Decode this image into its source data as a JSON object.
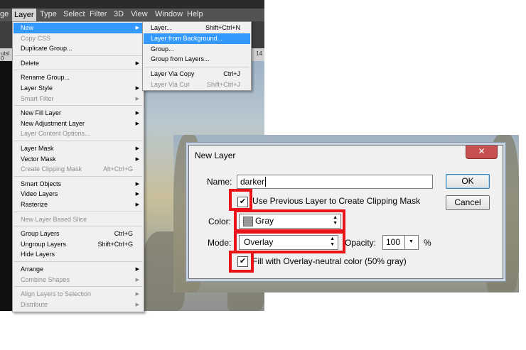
{
  "menubar": {
    "items": [
      "ge",
      "Layer",
      "Type",
      "Select",
      "Filter",
      "3D",
      "View",
      "Window",
      "Help"
    ]
  },
  "ruler": {
    "left_numbers": [
      "utsl",
      "0"
    ],
    "right_number": "14"
  },
  "layer_menu": {
    "items": [
      {
        "label": "New",
        "shortcut": "",
        "submenu": true,
        "disabled": false,
        "highlighted": true
      },
      {
        "label": "Copy CSS",
        "shortcut": "",
        "submenu": false,
        "disabled": true
      },
      {
        "label": "Duplicate Group...",
        "shortcut": "",
        "submenu": false,
        "disabled": false
      },
      {
        "label": "Delete",
        "shortcut": "",
        "submenu": true,
        "disabled": false
      },
      {
        "label": "Rename Group...",
        "shortcut": "",
        "submenu": false,
        "disabled": false
      },
      {
        "label": "Layer Style",
        "shortcut": "",
        "submenu": true,
        "disabled": false
      },
      {
        "label": "Smart Filter",
        "shortcut": "",
        "submenu": true,
        "disabled": true
      },
      {
        "label": "New Fill Layer",
        "shortcut": "",
        "submenu": true,
        "disabled": false
      },
      {
        "label": "New Adjustment Layer",
        "shortcut": "",
        "submenu": true,
        "disabled": false
      },
      {
        "label": "Layer Content Options...",
        "shortcut": "",
        "submenu": false,
        "disabled": true
      },
      {
        "label": "Layer Mask",
        "shortcut": "",
        "submenu": true,
        "disabled": false
      },
      {
        "label": "Vector Mask",
        "shortcut": "",
        "submenu": true,
        "disabled": false
      },
      {
        "label": "Create Clipping Mask",
        "shortcut": "Alt+Ctrl+G",
        "submenu": false,
        "disabled": true
      },
      {
        "label": "Smart Objects",
        "shortcut": "",
        "submenu": true,
        "disabled": false
      },
      {
        "label": "Video Layers",
        "shortcut": "",
        "submenu": true,
        "disabled": false
      },
      {
        "label": "Rasterize",
        "shortcut": "",
        "submenu": true,
        "disabled": false
      },
      {
        "label": "New Layer Based Slice",
        "shortcut": "",
        "submenu": false,
        "disabled": true
      },
      {
        "label": "Group Layers",
        "shortcut": "Ctrl+G",
        "submenu": false,
        "disabled": false
      },
      {
        "label": "Ungroup Layers",
        "shortcut": "Shift+Ctrl+G",
        "submenu": false,
        "disabled": false
      },
      {
        "label": "Hide Layers",
        "shortcut": "",
        "submenu": false,
        "disabled": false
      },
      {
        "label": "Arrange",
        "shortcut": "",
        "submenu": true,
        "disabled": false
      },
      {
        "label": "Combine Shapes",
        "shortcut": "",
        "submenu": true,
        "disabled": true
      },
      {
        "label": "Align Layers to Selection",
        "shortcut": "",
        "submenu": true,
        "disabled": true
      },
      {
        "label": "Distribute",
        "shortcut": "",
        "submenu": true,
        "disabled": true
      }
    ]
  },
  "new_submenu": {
    "items": [
      {
        "label": "Layer...",
        "shortcut": "Shift+Ctrl+N",
        "disabled": false,
        "highlighted": false
      },
      {
        "label": "Layer from Background...",
        "shortcut": "",
        "disabled": false,
        "highlighted": true
      },
      {
        "label": "Group...",
        "shortcut": "",
        "disabled": false,
        "highlighted": false
      },
      {
        "label": "Group from Layers...",
        "shortcut": "",
        "disabled": false,
        "highlighted": false
      },
      {
        "label": "Layer Via Copy",
        "shortcut": "Ctrl+J",
        "disabled": false,
        "highlighted": false
      },
      {
        "label": "Layer Via Cut",
        "shortcut": "Shift+Ctrl+J",
        "disabled": true,
        "highlighted": false
      }
    ]
  },
  "dialog": {
    "title": "New Layer",
    "close_glyph": "✕",
    "name_label": "Name:",
    "name_value": "darker",
    "ok_label": "OK",
    "cancel_label": "Cancel",
    "clip_checked": true,
    "clip_label": "Use Previous Layer to Create Clipping Mask",
    "color_label": "Color:",
    "color_value": "Gray",
    "mode_label": "Mode:",
    "mode_value": "Overlay",
    "opacity_label": "Opacity:",
    "opacity_value": "100",
    "opacity_unit": "%",
    "fill_checked": true,
    "fill_label": "Fill with Overlay-neutral color (50% gray)"
  },
  "colors": {
    "highlight": "#3399ff",
    "annotation_red": "#e8141a",
    "close_button": "#c75050"
  }
}
